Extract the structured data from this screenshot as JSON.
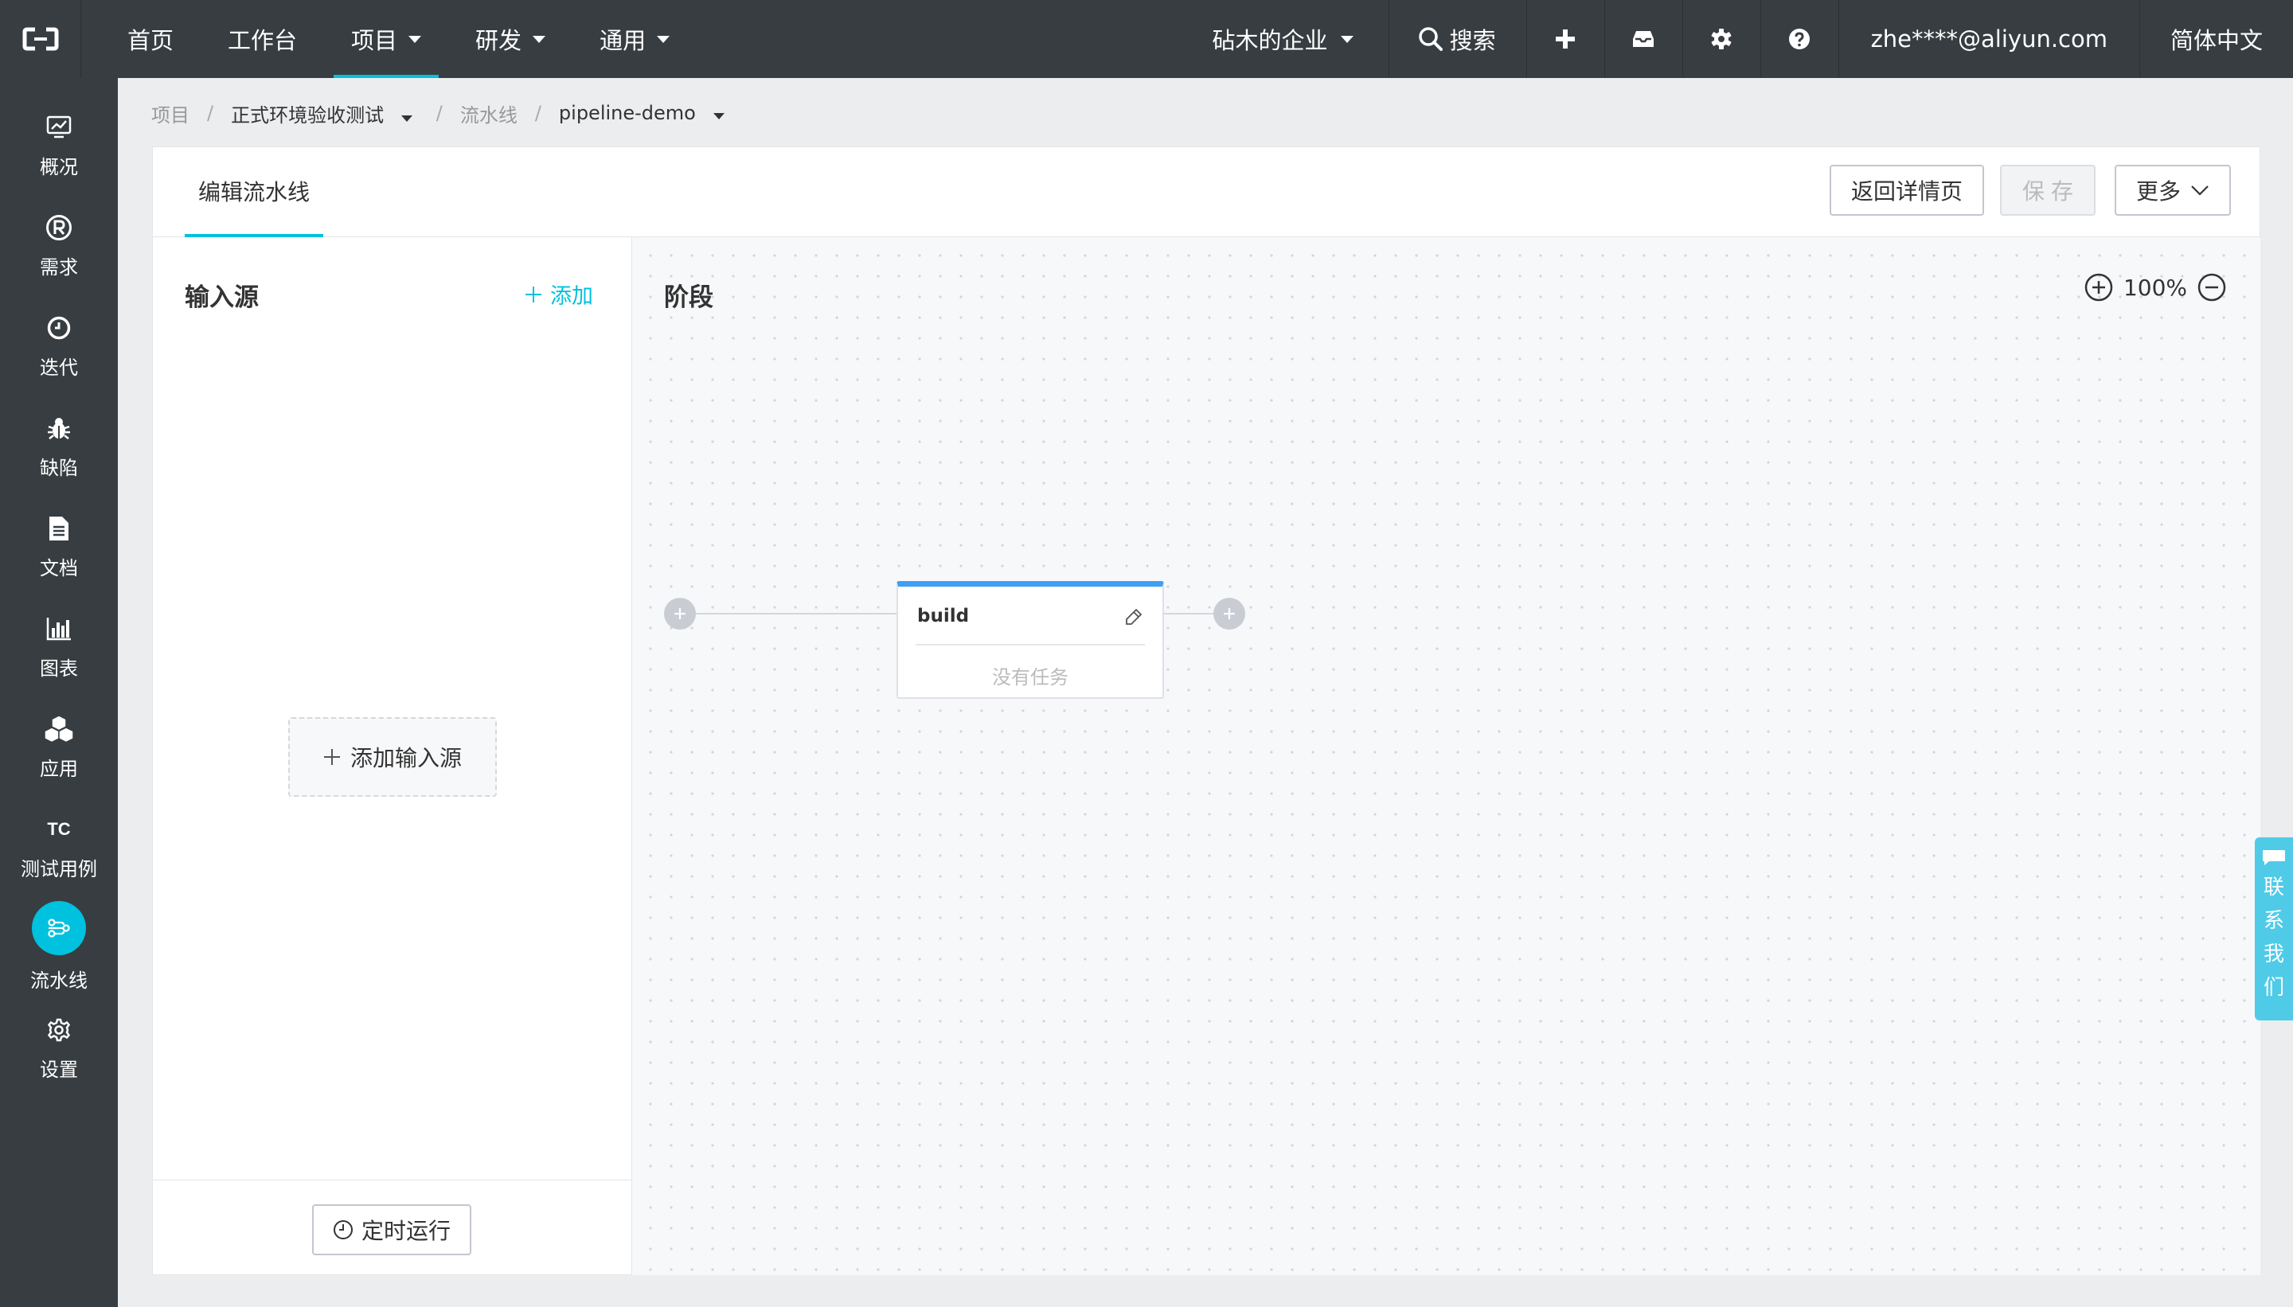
{
  "topnav": {
    "items": [
      {
        "label": "首页"
      },
      {
        "label": "工作台"
      },
      {
        "label": "项目"
      },
      {
        "label": "研发"
      },
      {
        "label": "通用"
      }
    ],
    "org": "砧木的企业",
    "search": "搜索",
    "user": "zhe****@aliyun.com",
    "language": "简体中文"
  },
  "sidebar": {
    "items": [
      {
        "label": "概况",
        "icon": "monitor-chart-icon"
      },
      {
        "label": "需求",
        "icon": "registered-icon"
      },
      {
        "label": "迭代",
        "icon": "clock-icon"
      },
      {
        "label": "缺陷",
        "icon": "bug-icon"
      },
      {
        "label": "文档",
        "icon": "document-icon"
      },
      {
        "label": "图表",
        "icon": "bar-chart-icon"
      },
      {
        "label": "应用",
        "icon": "cubes-icon"
      },
      {
        "label": "测试用例",
        "icon": "tc-icon",
        "icon_text": "TC"
      },
      {
        "label": "流水线",
        "icon": "pipeline-icon"
      },
      {
        "label": "设置",
        "icon": "gear-icon"
      }
    ],
    "active": "流水线"
  },
  "breadcrumb": {
    "root": "项目",
    "project": "正式环境验收测试",
    "section": "流水线",
    "pipeline": "pipeline-demo"
  },
  "header": {
    "tab": "编辑流水线",
    "back_button": "返回详情页",
    "save_button": "保存",
    "more_button": "更多"
  },
  "sources": {
    "title": "输入源",
    "add_link": "添加",
    "add_source_button": "添加输入源",
    "timer_button": "定时运行"
  },
  "stages": {
    "title": "阶段",
    "zoom": "100%",
    "cards": [
      {
        "name": "build",
        "empty_text": "没有任务"
      }
    ]
  },
  "contact": {
    "label": [
      "联",
      "系",
      "我",
      "们"
    ]
  },
  "colors": {
    "accent": "#00c1de",
    "stage_top": "#3e9ff3",
    "nav_bg": "#373d41"
  }
}
